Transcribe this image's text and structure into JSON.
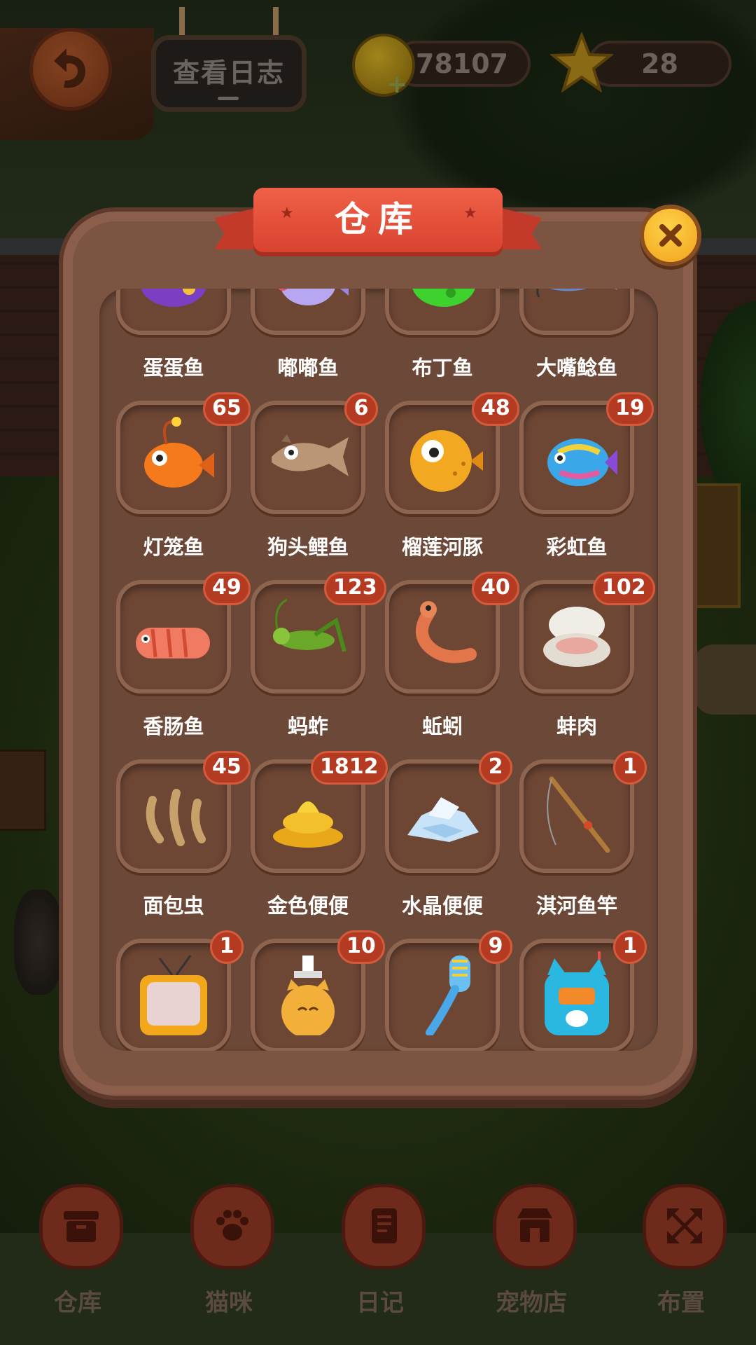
{
  "hud": {
    "log_button": "查看日志",
    "coins": "78107",
    "coin_plus": "+",
    "stars": "28"
  },
  "panel": {
    "title": "仓库"
  },
  "items": [
    {
      "name": "蛋蛋鱼",
      "count": "",
      "icon": "purple-spotted-fish-icon"
    },
    {
      "name": "嘟嘟鱼",
      "count": "",
      "icon": "lavender-fish-icon"
    },
    {
      "name": "布丁鱼",
      "count": "",
      "icon": "green-pudding-fish-icon"
    },
    {
      "name": "大嘴鲶鱼",
      "count": "",
      "icon": "catfish-icon"
    },
    {
      "name": "灯笼鱼",
      "count": "65",
      "icon": "lantern-fish-icon"
    },
    {
      "name": "狗头鲤鱼",
      "count": "6",
      "icon": "carp-icon"
    },
    {
      "name": "榴莲河豚",
      "count": "48",
      "icon": "puffer-fish-icon"
    },
    {
      "name": "彩虹鱼",
      "count": "19",
      "icon": "rainbow-fish-icon"
    },
    {
      "name": "香肠鱼",
      "count": "49",
      "icon": "sausage-fish-icon"
    },
    {
      "name": "蚂蚱",
      "count": "123",
      "icon": "grasshopper-icon"
    },
    {
      "name": "蚯蚓",
      "count": "40",
      "icon": "earthworm-icon"
    },
    {
      "name": "蚌肉",
      "count": "102",
      "icon": "clam-icon"
    },
    {
      "name": "面包虫",
      "count": "45",
      "icon": "mealworm-icon"
    },
    {
      "name": "金色便便",
      "count": "1812",
      "icon": "golden-poop-icon"
    },
    {
      "name": "水晶便便",
      "count": "2",
      "icon": "crystal-poop-icon"
    },
    {
      "name": "淇河鱼竿",
      "count": "1",
      "icon": "fishing-rod-icon"
    },
    {
      "name": "",
      "count": "1",
      "icon": "tv-icon"
    },
    {
      "name": "",
      "count": "10",
      "icon": "cat-lotion-bottle-icon"
    },
    {
      "name": "",
      "count": "9",
      "icon": "brush-icon"
    },
    {
      "name": "",
      "count": "1",
      "icon": "cat-radio-icon"
    }
  ],
  "nav": [
    {
      "label": "仓库",
      "icon": "storage-box-icon"
    },
    {
      "label": "猫咪",
      "icon": "paw-icon"
    },
    {
      "label": "日记",
      "icon": "diary-icon"
    },
    {
      "label": "宠物店",
      "icon": "pet-shop-icon"
    },
    {
      "label": "布置",
      "icon": "arrange-icon"
    }
  ],
  "colors": {
    "ribbon": "#e4503a",
    "badge": "#b43a22",
    "close": "#f8b82a",
    "panel": "#7c5442"
  }
}
